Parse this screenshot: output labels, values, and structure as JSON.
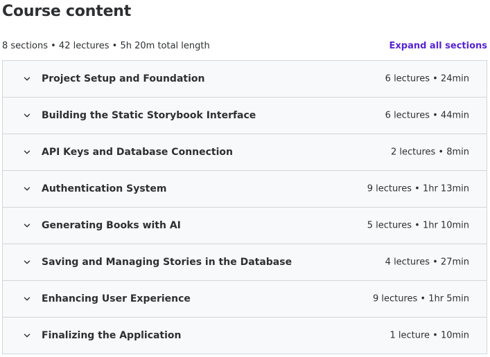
{
  "header": {
    "title": "Course content",
    "summary": "8 sections • 42 lectures • 5h 20m total length",
    "expand_label": "Expand all sections"
  },
  "colors": {
    "accent": "#5624d0",
    "text": "#2d2f31",
    "section_bg": "#f7f9fa",
    "border": "#d1d7dc"
  },
  "sections": [
    {
      "title": "Project Setup and Foundation",
      "meta": "6 lectures • 24min",
      "icon": "chevron-down-icon"
    },
    {
      "title": "Building the Static Storybook Interface",
      "meta": "6 lectures • 44min",
      "icon": "chevron-down-icon"
    },
    {
      "title": "API Keys and Database Connection",
      "meta": "2 lectures • 8min",
      "icon": "chevron-down-icon"
    },
    {
      "title": "Authentication System",
      "meta": "9 lectures • 1hr 13min",
      "icon": "chevron-down-icon"
    },
    {
      "title": "Generating Books with AI",
      "meta": "5 lectures • 1hr 10min",
      "icon": "chevron-down-icon"
    },
    {
      "title": "Saving and Managing Stories in the Database",
      "meta": "4 lectures • 27min",
      "icon": "chevron-down-icon"
    },
    {
      "title": "Enhancing User Experience",
      "meta": "9 lectures • 1hr 5min",
      "icon": "chevron-down-icon"
    },
    {
      "title": "Finalizing the Application",
      "meta": "1 lecture • 10min",
      "icon": "chevron-down-icon"
    }
  ]
}
